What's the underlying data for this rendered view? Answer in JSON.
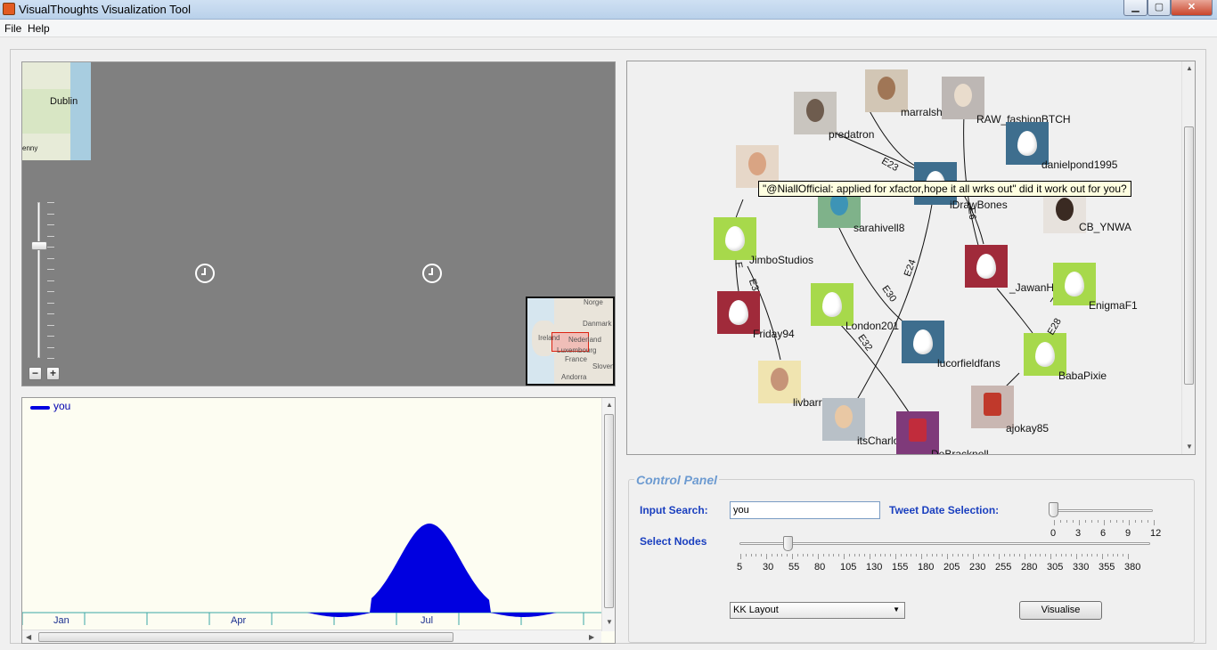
{
  "window": {
    "title": "VisualThoughts Visualization Tool",
    "minimize": "▁",
    "maximize": "▢",
    "close": "✕"
  },
  "menu": [
    "File",
    "Help"
  ],
  "map": {
    "tile_labels": [
      "Dublin",
      "enny"
    ],
    "zoom_in": "+",
    "zoom_out": "−",
    "zoom_level": 0.35,
    "minimap_labels": [
      "Norge",
      "Danmark",
      "Ireland",
      "Nederland",
      "Luxembourg",
      "France",
      "Slovení",
      "Andorra"
    ]
  },
  "timeline": {
    "legend": "you",
    "months": [
      "Jan",
      "Apr",
      "Jul"
    ]
  },
  "chart_data": {
    "type": "area",
    "series": [
      {
        "name": "you",
        "color": "#0000e0"
      }
    ],
    "xlabel": "",
    "ylabel": "",
    "x_ticks": [
      "Jan",
      "Apr",
      "Jul"
    ],
    "peak_month": "Jul"
  },
  "graph": {
    "nodes": [
      {
        "name": "predatron",
        "kind": "photo"
      },
      {
        "name": "marralshamshiri",
        "kind": "photo"
      },
      {
        "name": "RAW_fashionBTCH",
        "kind": "photo"
      },
      {
        "name": "danielpond1995",
        "kind": "egg"
      },
      {
        "name": "iDrawBones",
        "kind": "egg"
      },
      {
        "name": "CB_YNWA",
        "kind": "photo"
      },
      {
        "name": "sarahivell8",
        "kind": "photo"
      },
      {
        "name": "JimboStudios",
        "kind": "egg"
      },
      {
        "name": "_JawanHassan",
        "kind": "egg"
      },
      {
        "name": "EnigmaF1",
        "kind": "egg"
      },
      {
        "name": "London201",
        "kind": "egg"
      },
      {
        "name": "Friday94",
        "kind": "egg"
      },
      {
        "name": "lucorfieldfans",
        "kind": "egg"
      },
      {
        "name": "BabaPixie",
        "kind": "egg"
      },
      {
        "name": "livbarryx",
        "kind": "photo"
      },
      {
        "name": "ajokay85",
        "kind": "photo"
      },
      {
        "name": "itsCharlotte_x",
        "kind": "photo"
      },
      {
        "name": "DeBracknell",
        "kind": "photo"
      }
    ],
    "edges": [
      "E23",
      "E6",
      "E24",
      "E30",
      "E32",
      "E3",
      "E",
      "E28"
    ],
    "tooltip": "\"@NiallOfficial: applied for xfactor,hope it all wrks out\" did it work out for you?"
  },
  "control_panel": {
    "title": "Control Panel",
    "search_label": "Input Search:",
    "search_value": "you",
    "date_label": "Tweet Date Selection:",
    "date_ticks": [
      "0",
      "3",
      "6",
      "9",
      "12"
    ],
    "date_value": 0,
    "nodes_label": "Select Nodes",
    "nodes_ticks": [
      "5",
      "30",
      "55",
      "80",
      "105",
      "130",
      "155",
      "180",
      "205",
      "230",
      "255",
      "280",
      "305",
      "330",
      "355",
      "380"
    ],
    "nodes_value": 55,
    "layout_value": "KK Layout",
    "visualise_label": "Visualise"
  },
  "colors": {
    "egg_green": "#a7d94b",
    "egg_blue": "#3e6e8e",
    "egg_red": "#a02a3a",
    "series_blue": "#0000e0",
    "label_blue": "#1a3fbf"
  }
}
